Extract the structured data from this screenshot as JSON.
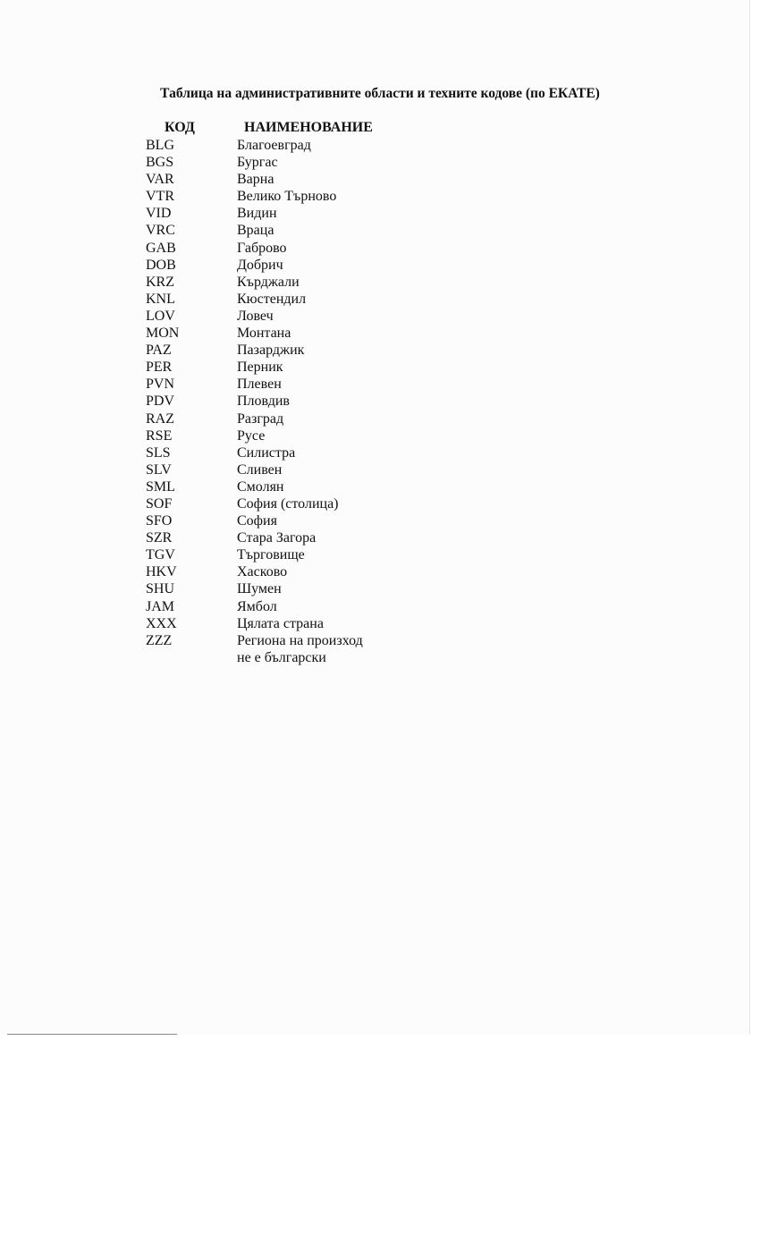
{
  "title": "Таблица на административните области и техните кодове (по ЕКАТЕ)",
  "table": {
    "headers": {
      "code": "КОД",
      "name": "НАИМЕНОВАНИЕ"
    },
    "rows": [
      {
        "code": "BLG",
        "name": "Благоевград"
      },
      {
        "code": "BGS",
        "name": "Бургас"
      },
      {
        "code": "VAR",
        "name": "Варна"
      },
      {
        "code": "VTR",
        "name": "Велико Търново"
      },
      {
        "code": "VID",
        "name": "Видин"
      },
      {
        "code": "VRC",
        "name": "Враца"
      },
      {
        "code": "GAB",
        "name": "Габрово"
      },
      {
        "code": "DOB",
        "name": "Добрич"
      },
      {
        "code": "KRZ",
        "name": "Кърджали"
      },
      {
        "code": "KNL",
        "name": "Кюстендил"
      },
      {
        "code": "LOV",
        "name": "Ловеч"
      },
      {
        "code": "MON",
        "name": "Монтана"
      },
      {
        "code": "PAZ",
        "name": "Пазарджик"
      },
      {
        "code": "PER",
        "name": "Перник"
      },
      {
        "code": "PVN",
        "name": "Плевен"
      },
      {
        "code": "PDV",
        "name": "Пловдив"
      },
      {
        "code": "RAZ",
        "name": "Разград"
      },
      {
        "code": "RSE",
        "name": "Русе"
      },
      {
        "code": "SLS",
        "name": "Силистра"
      },
      {
        "code": "SLV",
        "name": "Сливен"
      },
      {
        "code": "SML",
        "name": "Смолян"
      },
      {
        "code": "SOF",
        "name": "София (столица)"
      },
      {
        "code": "SFO",
        "name": "София"
      },
      {
        "code": "SZR",
        "name": "Стара Загора"
      },
      {
        "code": "TGV",
        "name": "Търговище"
      },
      {
        "code": "HKV",
        "name": "Хасково"
      },
      {
        "code": "SHU",
        "name": "Шумен"
      },
      {
        "code": "JAM",
        "name": "Ямбол"
      },
      {
        "code": "XXX",
        "name": "Цялата страна"
      },
      {
        "code": "ZZZ",
        "name": "Региона на произход",
        "name_line2": "не е български"
      }
    ]
  }
}
